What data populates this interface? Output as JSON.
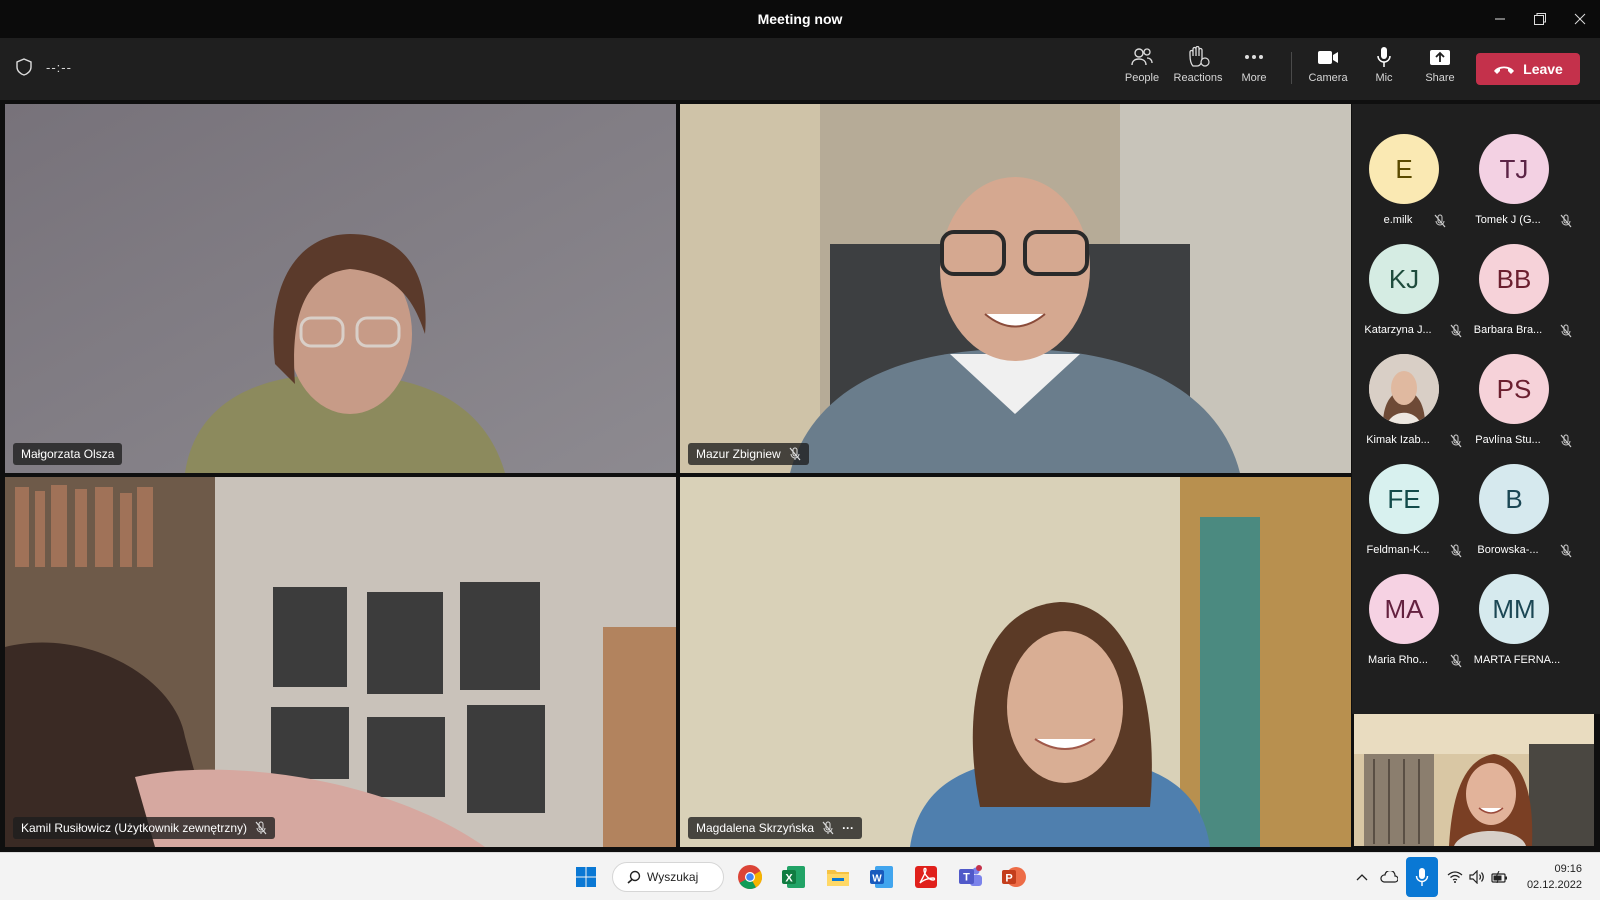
{
  "window": {
    "title": "Meeting now"
  },
  "toolbar": {
    "timer": "--:--",
    "buttons": {
      "people": "People",
      "reactions": "Reactions",
      "more": "More",
      "camera": "Camera",
      "mic": "Mic",
      "share": "Share"
    },
    "leave": "Leave"
  },
  "videos": [
    {
      "name": "Małgorzata Olsza",
      "muted": false,
      "active": true
    },
    {
      "name": "Mazur Zbigniew",
      "muted": true
    },
    {
      "name": "Kamil Rusiłowicz (Użytkownik zewnętrzny)",
      "muted": true
    },
    {
      "name": "Magdalena Skrzyńska",
      "muted": true,
      "more": "···"
    }
  ],
  "participants": [
    {
      "initials": "E",
      "name": "e.milk",
      "bg": "#fae9b3",
      "fg": "#5a4a00"
    },
    {
      "initials": "TJ",
      "name": "Tomek J (G...",
      "bg": "#f3d1e3",
      "fg": "#5b2446"
    },
    {
      "initials": "KJ",
      "name": "Katarzyna J...",
      "bg": "#d5ece3",
      "fg": "#1e4b3c"
    },
    {
      "initials": "BB",
      "name": "Barbara Bra...",
      "bg": "#f6d2d9",
      "fg": "#6b1f2f"
    },
    {
      "initials": "",
      "name": "Kimak Izab...",
      "bg": "#b9916f",
      "fg": "#ffffff"
    },
    {
      "initials": "PS",
      "name": "Pavlína Stu...",
      "bg": "#f6d2d9",
      "fg": "#6b1f2f"
    },
    {
      "initials": "FE",
      "name": "Feldman-K...",
      "bg": "#d8f1ef",
      "fg": "#124b4a"
    },
    {
      "initials": "B",
      "name": "Borowska-...",
      "bg": "#d6e9ee",
      "fg": "#1b4754"
    },
    {
      "initials": "MA",
      "name": "Maria Rho...",
      "bg": "#f6d2e3",
      "fg": "#64213f"
    },
    {
      "initials": "MM",
      "name": "MARTA FERNA...",
      "bg": "#d6eaee",
      "fg": "#1b4754"
    }
  ],
  "taskbar": {
    "search": "Wyszukaj",
    "time": "09:16",
    "date": "02.12.2022"
  },
  "colors": {
    "accent": "#7f85f5",
    "leave": "#c4314b",
    "panel": "#1f1f1f"
  }
}
